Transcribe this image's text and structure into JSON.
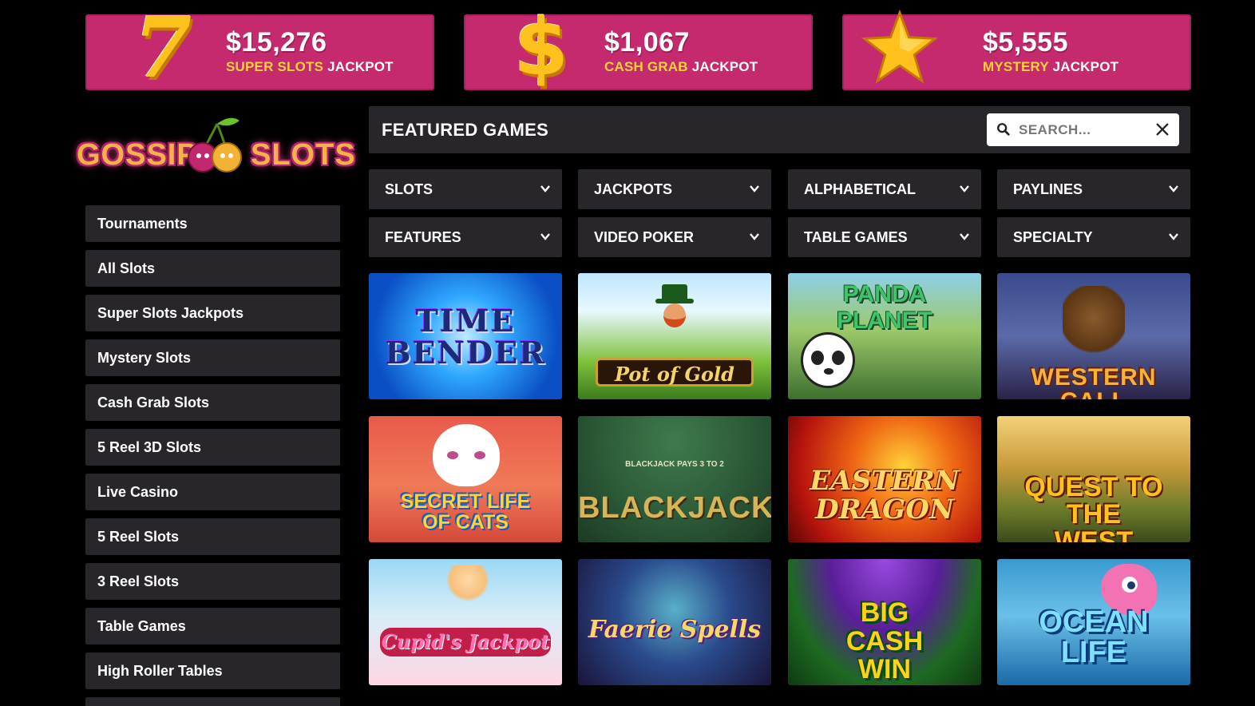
{
  "jackpots": [
    {
      "amount": "$15,276",
      "highlight": "SUPER SLOTS",
      "rest": "JACKPOT",
      "icon": "seven-icon"
    },
    {
      "amount": "$1,067",
      "highlight": "CASH GRAB",
      "rest": "JACKPOT",
      "icon": "dollar-icon"
    },
    {
      "amount": "$5,555",
      "highlight": "MYSTERY",
      "rest": "JACKPOT",
      "icon": "star-icon"
    }
  ],
  "logo": {
    "word1": "GOSSIP",
    "word2": "SLOTS"
  },
  "sidebar": {
    "items": [
      {
        "label": "Tournaments"
      },
      {
        "label": "All Slots"
      },
      {
        "label": "Super Slots Jackpots"
      },
      {
        "label": "Mystery Slots"
      },
      {
        "label": "Cash Grab Slots"
      },
      {
        "label": "5 Reel 3D Slots"
      },
      {
        "label": "Live Casino"
      },
      {
        "label": "5 Reel Slots"
      },
      {
        "label": "3 Reel Slots"
      },
      {
        "label": "Table Games"
      },
      {
        "label": "High Roller Tables"
      }
    ]
  },
  "featured": {
    "title": "FEATURED GAMES"
  },
  "search": {
    "placeholder": "SEARCH..."
  },
  "filters": [
    {
      "label": "SLOTS"
    },
    {
      "label": "JACKPOTS"
    },
    {
      "label": "ALPHABETICAL"
    },
    {
      "label": "PAYLINES"
    },
    {
      "label": "FEATURES"
    },
    {
      "label": "VIDEO POKER"
    },
    {
      "label": "TABLE GAMES"
    },
    {
      "label": "SPECIALTY"
    }
  ],
  "games": [
    {
      "title": "TIME BENDER"
    },
    {
      "title": "Pot of Gold"
    },
    {
      "title": "PANDA PLANET"
    },
    {
      "title": "WESTERN CALL"
    },
    {
      "title": "SECRET LIFE OF CATS"
    },
    {
      "title": "BLACKJACK",
      "subtitle": "BLACKJACK PAYS 3 TO 2"
    },
    {
      "title": "EASTERN DRAGON"
    },
    {
      "title": "QUEST TO THE WEST"
    },
    {
      "title": "Cupid's Jackpot"
    },
    {
      "title": "Faerie Spells"
    },
    {
      "title": "BIG CASH WIN"
    },
    {
      "title": "OCEAN LIFE"
    }
  ],
  "colors": {
    "brand_pink": "#c62a6e",
    "gold": "#ffd23a",
    "panel": "#29262b"
  }
}
